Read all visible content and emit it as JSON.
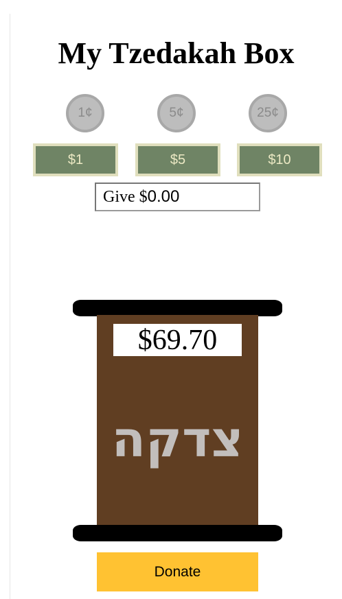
{
  "title": "My Tzedakah Box",
  "coins": [
    {
      "label": "1¢"
    },
    {
      "label": "5¢"
    },
    {
      "label": "25¢"
    }
  ],
  "bills": [
    {
      "label": "$1"
    },
    {
      "label": "$5"
    },
    {
      "label": "$10"
    }
  ],
  "give": {
    "label": "Give $",
    "amount": "0.00"
  },
  "box": {
    "total": "$69.70",
    "hebrew_text": "צדקה",
    "colors": {
      "body": "#603e22",
      "caps": "#000000",
      "hebrew_text": "#c2bebc"
    }
  },
  "donate": {
    "label": "Donate",
    "color": "#ffc232"
  },
  "colors": {
    "coin_fill": "#bdbdbd",
    "bill_fill": "#6f8465",
    "bill_border": "#e0dfbd"
  }
}
